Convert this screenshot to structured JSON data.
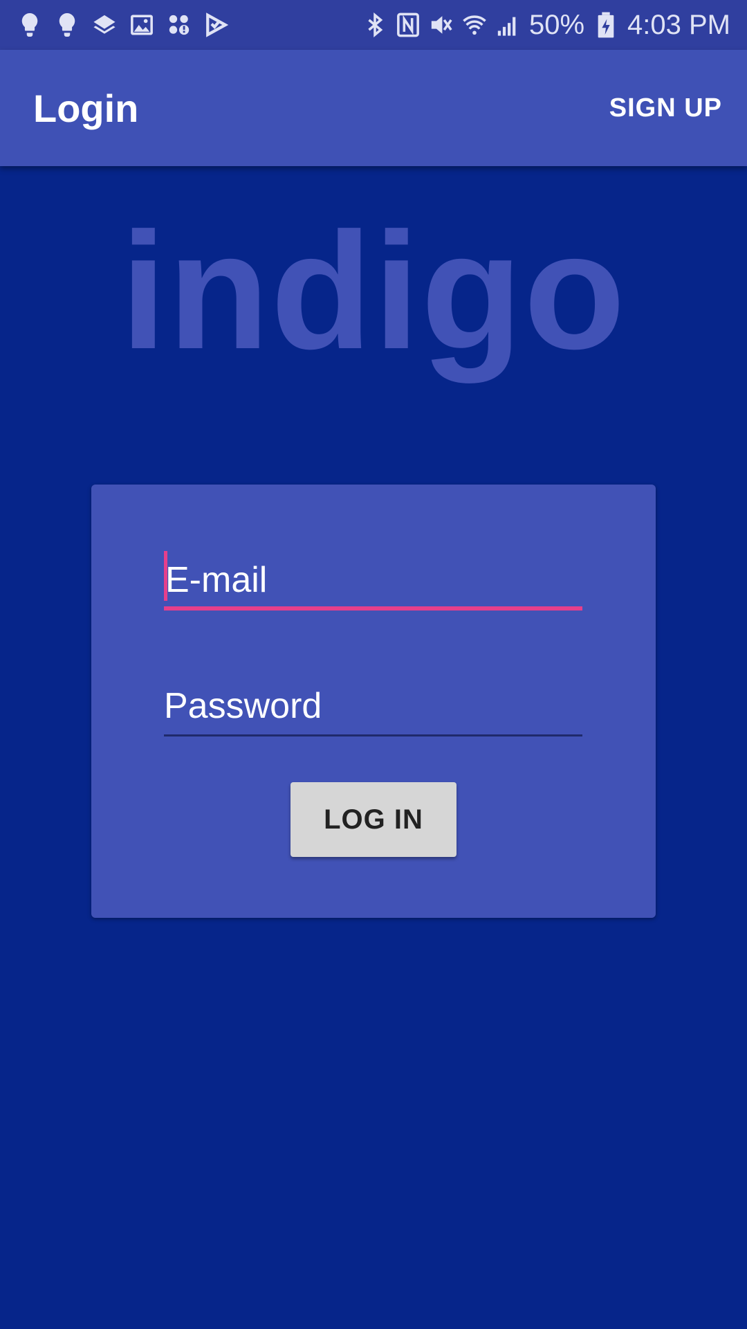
{
  "status_bar": {
    "icons_left": [
      "bulb-icon",
      "bulb-icon",
      "layers-icon",
      "image-icon",
      "apps-alert-icon",
      "check-flag-icon"
    ],
    "icons_right": [
      "bluetooth-icon",
      "nfc-icon",
      "mute-icon",
      "wifi-icon",
      "signal-icon",
      "battery-charging-icon"
    ],
    "battery": "50%",
    "time": "4:03 PM"
  },
  "app_bar": {
    "title": "Login",
    "signup_label": "SIGN UP"
  },
  "logo": {
    "text": "indigo"
  },
  "login_form": {
    "email_placeholder": "E-mail",
    "password_placeholder": "Password",
    "login_label": "LOG IN"
  },
  "colors": {
    "background": "#06258a",
    "status_bar": "#303f9f",
    "app_bar": "#3f51b5",
    "card": "#4152b6",
    "accent": "#e63f8b",
    "button": "#d6d6d6"
  }
}
